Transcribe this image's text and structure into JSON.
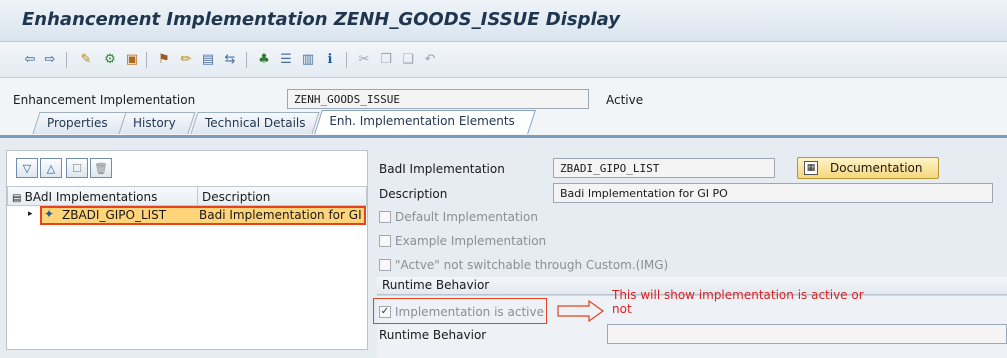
{
  "window": {
    "title": "Enhancement Implementation ZENH_GOODS_ISSUE Display"
  },
  "toolbar": {
    "icons": [
      "back-arrow-icon",
      "forward-arrow-icon",
      "display-change-icon",
      "other-object-icon",
      "check-icon",
      "activate-icon",
      "where-used-icon",
      "object-list-icon",
      "navigation-window-icon",
      "hierarchy-icon",
      "info-icon",
      "cut-icon",
      "copy-icon",
      "paste-icon"
    ]
  },
  "header": {
    "label": "Enhancement Implementation",
    "value": "ZENH_GOODS_ISSUE",
    "status": "Active"
  },
  "tabs": [
    {
      "label": "Properties"
    },
    {
      "label": "History"
    },
    {
      "label": "Technical Details"
    },
    {
      "label": "Enh. Implementation Elements",
      "active": true
    }
  ],
  "left_pane": {
    "columns": [
      "BAdI Implementations",
      "Description"
    ],
    "rows": [
      {
        "name": "ZBADI_GIPO_LIST",
        "description": "Badi Implementation for GI P"
      }
    ]
  },
  "details": {
    "badi_label": "BadI Implementation",
    "badi_value": "ZBADI_GIPO_LIST",
    "doc_button": "Documentation",
    "desc_label": "Description",
    "desc_value": "Badi Implementation for GI PO",
    "cb_default": "Default Implementation",
    "cb_example": "Example Implementation",
    "cb_not_switchable": "\"Actve\" not switchable through Custom.(IMG)",
    "runtime_group": "Runtime Behavior",
    "cb_active": "Implementation is active",
    "runtime_label": "Runtime Behavior"
  },
  "annotation": "This will show implementation is active or not",
  "colors": {
    "highlight": "#e5431e",
    "annotation": "#e02020",
    "selected_row": "#ffd47a",
    "tab_strip": "#7a9bbb"
  }
}
